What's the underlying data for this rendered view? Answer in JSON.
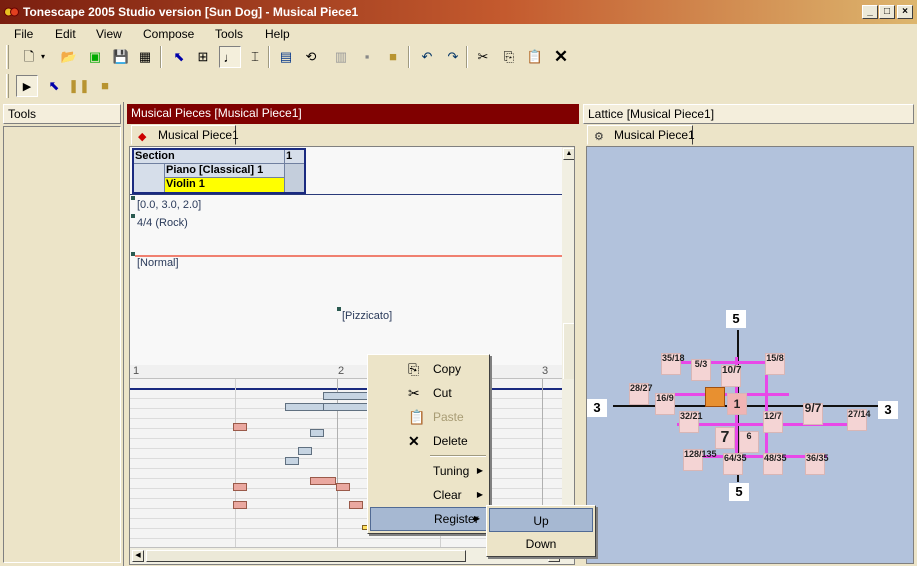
{
  "window": {
    "title": "Tonescape 2005 Studio  version [Sun Dog]  -  Musical Piece1"
  },
  "menu": [
    "File",
    "Edit",
    "View",
    "Compose",
    "Tools",
    "Help"
  ],
  "panels": {
    "tools": {
      "title": "Tools"
    },
    "pieces": {
      "title": "Musical Pieces  [Musical Piece1]",
      "tab": "Musical Piece1"
    },
    "lattice": {
      "title": "Lattice  [Musical Piece1]",
      "tab": "Musical Piece1"
    }
  },
  "grid": {
    "header": "Section",
    "col1": "1",
    "row1": "Piano [Classical] 1",
    "row2": "Violin 1"
  },
  "events": {
    "range": "[0.0, 3.0, 2.0]",
    "meter": "4/4 (Rock)",
    "normal": "[Normal]",
    "pizz": "[Pizzicato]"
  },
  "ruler": [
    "1",
    "2",
    "3"
  ],
  "context_menu": {
    "copy": "Copy",
    "cut": "Cut",
    "paste": "Paste",
    "delete": "Delete",
    "tuning": "Tuning",
    "clear": "Clear",
    "register": "Register",
    "paste_disabled": true
  },
  "submenu": {
    "up": "Up",
    "down": "Down"
  },
  "lattice": {
    "axis_top": "5",
    "axis_bottom": "5",
    "axis_left": "3",
    "axis_right": "3",
    "nodes": [
      "35/18",
      "5/3",
      "10/7",
      "15/8",
      "28/27",
      "16/9",
      "1",
      "7",
      "9/7",
      "27/14",
      "32/21",
      "6",
      "12/7",
      "128/135",
      "64/35",
      "48/35",
      "36/35"
    ]
  },
  "colors": {
    "title_start": "#7a1e0f",
    "panel_hdr_red": "#800000",
    "lattice_bg": "#b2c2dc",
    "violin_yellow": "#ffff00"
  }
}
